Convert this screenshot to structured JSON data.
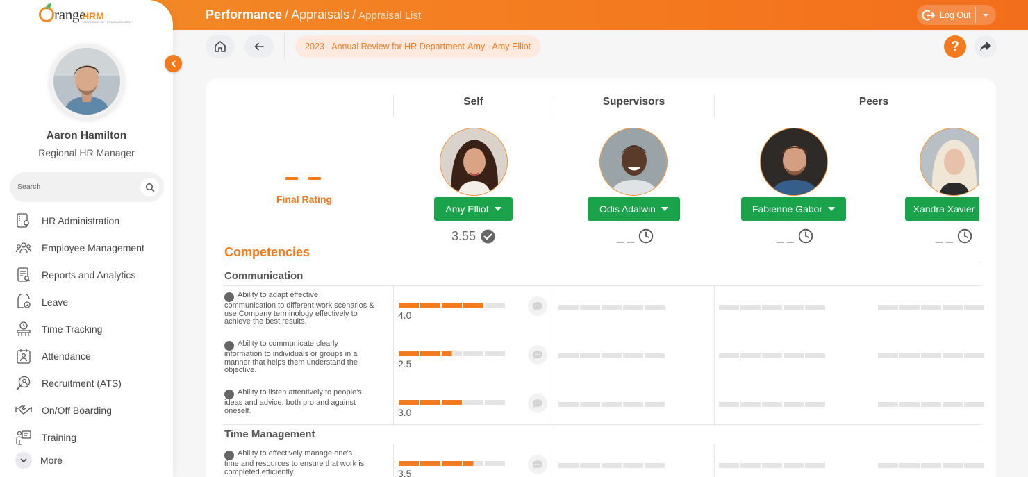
{
  "header": {
    "crumb_module": "Performance",
    "crumb_sep": "/",
    "crumb_section": "Appraisals",
    "crumb_page": "Appraisal List",
    "logout_label": "Log Out"
  },
  "brand": {
    "logo_text": "range",
    "logo_hrm": "HRM",
    "logo_tagline": "NEW LEVEL OF HR MANAGEMENT",
    "accent": "#f47a1f",
    "green": "#1aa34a"
  },
  "user": {
    "name": "Aaron Hamilton",
    "role": "Regional HR Manager"
  },
  "search": {
    "placeholder": "Search",
    "value": ""
  },
  "menu": [
    {
      "label": "HR Administration",
      "icon": "hr-admin-icon"
    },
    {
      "label": "Employee Management",
      "icon": "employees-icon"
    },
    {
      "label": "Reports and Analytics",
      "icon": "reports-icon"
    },
    {
      "label": "Leave",
      "icon": "leave-icon"
    },
    {
      "label": "Time Tracking",
      "icon": "time-tracking-icon"
    },
    {
      "label": "Attendance",
      "icon": "attendance-icon"
    },
    {
      "label": "Recruitment (ATS)",
      "icon": "recruitment-icon"
    },
    {
      "label": "On/Off Boarding",
      "icon": "handshake-icon"
    },
    {
      "label": "Training",
      "icon": "training-icon"
    },
    {
      "label": "More",
      "icon": "chevron-down-icon"
    }
  ],
  "subheader": {
    "appraisal_title": "2023 - Annual Review for HR Department-Amy - Amy Elliot",
    "help_label": "?"
  },
  "review": {
    "final_rating_label": "Final Rating",
    "columns": {
      "self": "Self",
      "supervisors": "Supervisors",
      "peers": "Peers"
    },
    "people": [
      {
        "name": "Amy Elliot",
        "score": "3.55",
        "status_icon": "check-circle-icon"
      },
      {
        "name": "Odis Adalwin",
        "score": "_ _",
        "status_icon": "clock-icon"
      },
      {
        "name": "Fabienne Gabor",
        "score": "_ _",
        "status_icon": "clock-icon"
      },
      {
        "name": "Xandra Xavier",
        "score": "_ _",
        "status_icon": "clock-icon"
      }
    ],
    "section_title": "Competencies",
    "groups": [
      {
        "title": "Communication",
        "items": [
          {
            "first_line": "Ability to adapt effective",
            "rest": "communication to different work scenarios & use Company terminology effectively to achieve the best results.",
            "rating": 4.0,
            "rating_text": "4.0"
          },
          {
            "first_line": "Ability to communicate clearly",
            "rest": "information to individuals or groups in a manner that helps them understand the objective.",
            "rating": 2.5,
            "rating_text": "2.5"
          },
          {
            "first_line": "Ability to listen attentively to people's",
            "rest": "ideas and advice, both pro and against oneself.",
            "rating": 3.0,
            "rating_text": "3.0"
          }
        ]
      },
      {
        "title": "Time Management",
        "items": [
          {
            "first_line": "Ability to effectively manage one's",
            "rest": "time and resources to ensure that work is completed efficiently.",
            "rating": 3.5,
            "rating_text": "3.5"
          }
        ]
      }
    ]
  }
}
